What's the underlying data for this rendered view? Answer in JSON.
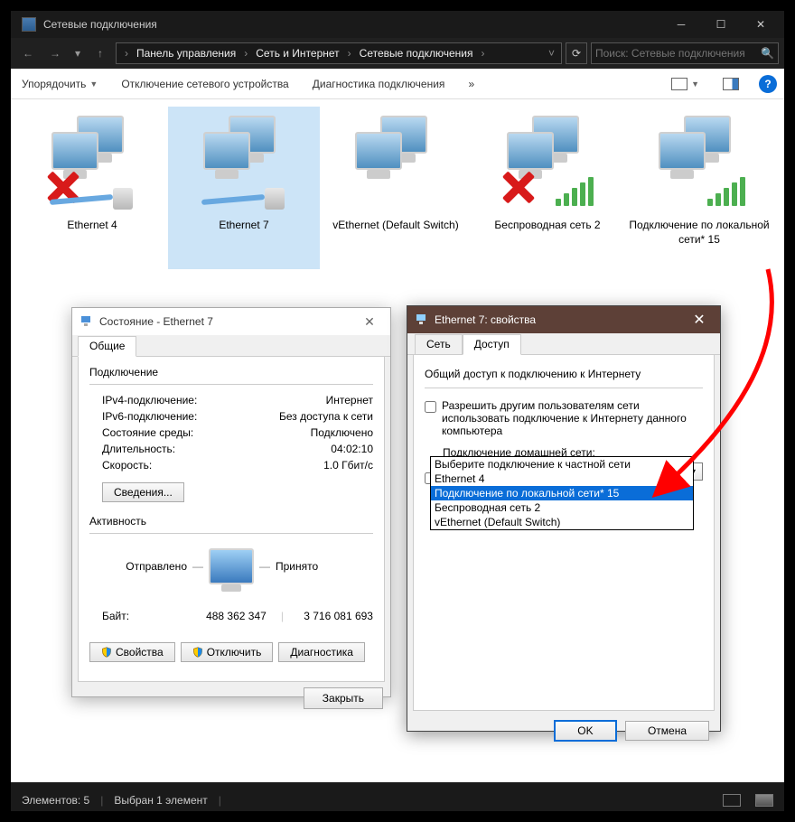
{
  "window": {
    "title": "Сетевые подключения"
  },
  "breadcrumb": {
    "root": "Панель управления",
    "level1": "Сеть и Интернет",
    "level2": "Сетевые подключения"
  },
  "search": {
    "placeholder": "Поиск: Сетевые подключения"
  },
  "toolbar": {
    "organize": "Упорядочить",
    "disable": "Отключение сетевого устройства",
    "diagnose": "Диагностика подключения"
  },
  "connections": [
    {
      "label": "Ethernet 4",
      "type": "ethernet",
      "state": "disconnected"
    },
    {
      "label": "Ethernet 7",
      "type": "ethernet",
      "state": "connected",
      "selected": true
    },
    {
      "label": "vEthernet (Default Switch)",
      "type": "virtual",
      "state": "connected"
    },
    {
      "label": "Беспроводная сеть 2",
      "type": "wifi",
      "state": "disconnected"
    },
    {
      "label": "Подключение по локальной сети* 15",
      "type": "wifi",
      "state": "connected"
    }
  ],
  "statusbar": {
    "count_label": "Элементов: 5",
    "selected_label": "Выбран 1 элемент"
  },
  "status_dialog": {
    "title": "Состояние - Ethernet 7",
    "tab_general": "Общие",
    "group_connection": "Подключение",
    "ipv4_label": "IPv4-подключение:",
    "ipv4_value": "Интернет",
    "ipv6_label": "IPv6-подключение:",
    "ipv6_value": "Без доступа к сети",
    "media_label": "Состояние среды:",
    "media_value": "Подключено",
    "duration_label": "Длительность:",
    "duration_value": "04:02:10",
    "speed_label": "Скорость:",
    "speed_value": "1.0 Гбит/с",
    "details_btn": "Сведения...",
    "group_activity": "Активность",
    "sent_label": "Отправлено",
    "recv_label": "Принято",
    "bytes_label": "Байт:",
    "bytes_sent": "488 362 347",
    "bytes_recv": "3 716 081 693",
    "btn_props": "Свойства",
    "btn_disable": "Отключить",
    "btn_diag": "Диагностика",
    "btn_close": "Закрыть"
  },
  "props_dialog": {
    "title": "Ethernet 7: свойства",
    "tab_network": "Сеть",
    "tab_access": "Доступ",
    "group_ics": "Общий доступ к подключению к Интернету",
    "check_allow": "Разрешить другим пользователям сети использовать подключение к Интернету данного компьютера",
    "home_conn_label": "Подключение домашней сети:",
    "combo_selected": "Выберите подключение к частной сети",
    "options": [
      "Выберите подключение к частной сети",
      "Ethernet 4",
      "Подключение по локальной сети* 15",
      "Беспроводная сеть 2",
      "vEthernet (Default Switch)"
    ],
    "btn_ok": "OK",
    "btn_cancel": "Отмена"
  }
}
